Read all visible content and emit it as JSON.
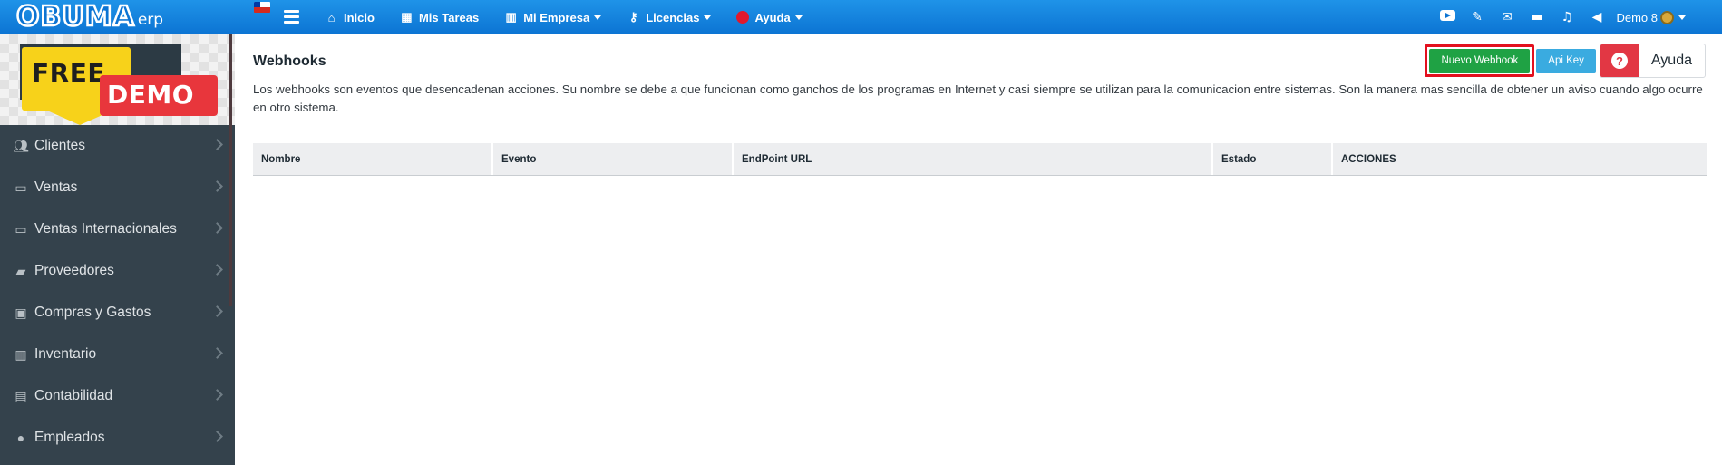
{
  "app": {
    "logo_text": "OBUMA",
    "logo_sub": "erp",
    "nav": [
      {
        "label": "Inicio",
        "icon": "home-icon"
      },
      {
        "label": "Mis Tareas",
        "icon": "calendar-icon"
      },
      {
        "label": "Mi Empresa",
        "icon": "building-icon",
        "dropdown": true
      },
      {
        "label": "Licencias",
        "icon": "key-icon",
        "dropdown": true
      },
      {
        "label": "Ayuda",
        "icon": "help-circle-icon",
        "dropdown": true
      }
    ],
    "right_icons": [
      "youtube-icon",
      "pen-icon",
      "envelope-icon",
      "folder-icon",
      "bell-icon",
      "megaphone-icon"
    ],
    "user": {
      "name": "Demo 8"
    }
  },
  "sidebar": {
    "banner": {
      "line1": "FREE",
      "line2": "DEMO"
    },
    "items": [
      {
        "label": "Clientes",
        "icon": "users-icon"
      },
      {
        "label": "Ventas",
        "icon": "money-icon"
      },
      {
        "label": "Ventas Internacionales",
        "icon": "money-icon"
      },
      {
        "label": "Proveedores",
        "icon": "truck-icon"
      },
      {
        "label": "Compras y Gastos",
        "icon": "cash-icon"
      },
      {
        "label": "Inventario",
        "icon": "barcode-icon"
      },
      {
        "label": "Contabilidad",
        "icon": "book-icon"
      },
      {
        "label": "Empleados",
        "icon": "people-icon"
      }
    ]
  },
  "page": {
    "title": "Webhooks",
    "description": "Los webhooks son eventos que desencadenan acciones. Su nombre se debe a que funcionan como ganchos de los programas en Internet y casi siempre se utilizan para la comunicacion entre sistemas. Son la manera mas sencilla de obtener un aviso cuando algo ocurre en otro sistema.",
    "buttons": {
      "new_webhook": "Nuevo Webhook",
      "api_key": "Api Key",
      "help": "Ayuda",
      "help_symbol": "?"
    },
    "table": {
      "columns": [
        "Nombre",
        "Evento",
        "EndPoint URL",
        "Estado",
        "ACCIONES"
      ]
    }
  },
  "colors": {
    "topbar": "#0c74d3",
    "sidebar": "#34424c",
    "green_button": "#1fa244",
    "blue_button": "#3aabe0",
    "help_red": "#e23744",
    "highlight": "#e3101e"
  }
}
